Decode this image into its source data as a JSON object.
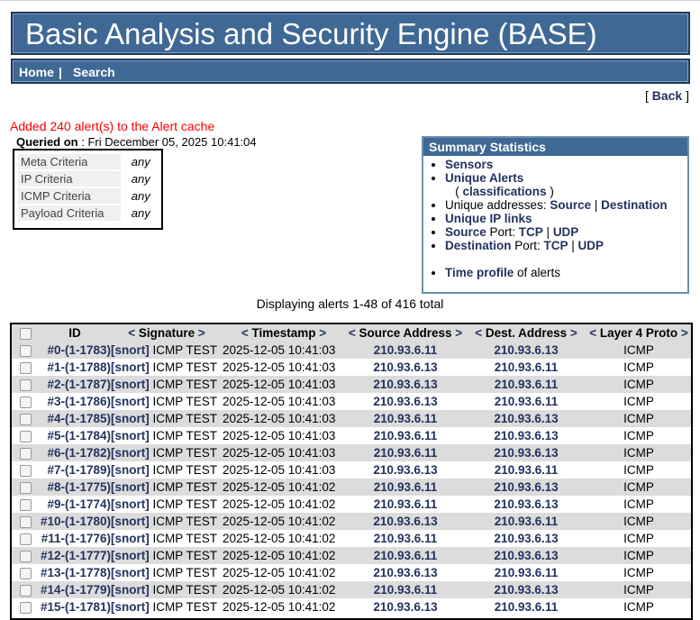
{
  "header": {
    "title": "Basic Analysis and Security Engine (BASE)"
  },
  "nav": {
    "home": "Home",
    "sep": "|",
    "search": "Search"
  },
  "back": {
    "open": "[ ",
    "label": "Back",
    "close": " ]"
  },
  "cache_message": "Added 240 alert(s) to the Alert cache",
  "queried": {
    "label": "Queried on",
    "value": " : Fri December 05, 2025 10:41:04"
  },
  "criteria": [
    {
      "label": "Meta Criteria",
      "value": "any"
    },
    {
      "label": "IP Criteria",
      "value": "any"
    },
    {
      "label": "ICMP Criteria",
      "value": "any"
    },
    {
      "label": "Payload Criteria",
      "value": "any"
    }
  ],
  "summary": {
    "title": "Summary Statistics",
    "sensors": "Sensors",
    "unique_alerts": "Unique Alerts",
    "classifications_open": "( ",
    "classifications": "classifications",
    "classifications_close": " )",
    "unique_addresses_label": "Unique addresses: ",
    "source": "Source",
    "pipe": " | ",
    "destination": "Destination",
    "unique_ip_links": "Unique IP links",
    "source_port_link": "Source",
    "port_label": " Port: ",
    "tcp": "TCP",
    "udp": "UDP",
    "destination_port_link": "Destination",
    "time_profile": "Time profile",
    "of_alerts": " of alerts"
  },
  "displaying": "Displaying alerts 1-48 of 416 total",
  "table": {
    "columns": {
      "id": "ID",
      "signature": "Signature",
      "timestamp": "Timestamp",
      "source": "Source Address",
      "dest": "Dest. Address",
      "proto": "Layer 4 Proto"
    },
    "arrow_left": "<",
    "arrow_right": ">",
    "rows": [
      {
        "id": "#0-(1-1783)",
        "sig_tag": "[snort]",
        "sig": " ICMP TEST",
        "ts": "2025-12-05 10:41:03",
        "src": "210.93.6.11",
        "dst": "210.93.6.13",
        "proto": "ICMP"
      },
      {
        "id": "#1-(1-1788)",
        "sig_tag": "[snort]",
        "sig": " ICMP TEST",
        "ts": "2025-12-05 10:41:03",
        "src": "210.93.6.13",
        "dst": "210.93.6.11",
        "proto": "ICMP"
      },
      {
        "id": "#2-(1-1787)",
        "sig_tag": "[snort]",
        "sig": " ICMP TEST",
        "ts": "2025-12-05 10:41:03",
        "src": "210.93.6.13",
        "dst": "210.93.6.11",
        "proto": "ICMP"
      },
      {
        "id": "#3-(1-1786)",
        "sig_tag": "[snort]",
        "sig": " ICMP TEST",
        "ts": "2025-12-05 10:41:03",
        "src": "210.93.6.13",
        "dst": "210.93.6.11",
        "proto": "ICMP"
      },
      {
        "id": "#4-(1-1785)",
        "sig_tag": "[snort]",
        "sig": " ICMP TEST",
        "ts": "2025-12-05 10:41:03",
        "src": "210.93.6.11",
        "dst": "210.93.6.13",
        "proto": "ICMP"
      },
      {
        "id": "#5-(1-1784)",
        "sig_tag": "[snort]",
        "sig": " ICMP TEST",
        "ts": "2025-12-05 10:41:03",
        "src": "210.93.6.11",
        "dst": "210.93.6.13",
        "proto": "ICMP"
      },
      {
        "id": "#6-(1-1782)",
        "sig_tag": "[snort]",
        "sig": " ICMP TEST",
        "ts": "2025-12-05 10:41:03",
        "src": "210.93.6.11",
        "dst": "210.93.6.13",
        "proto": "ICMP"
      },
      {
        "id": "#7-(1-1789)",
        "sig_tag": "[snort]",
        "sig": " ICMP TEST",
        "ts": "2025-12-05 10:41:03",
        "src": "210.93.6.13",
        "dst": "210.93.6.11",
        "proto": "ICMP"
      },
      {
        "id": "#8-(1-1775)",
        "sig_tag": "[snort]",
        "sig": " ICMP TEST",
        "ts": "2025-12-05 10:41:02",
        "src": "210.93.6.11",
        "dst": "210.93.6.13",
        "proto": "ICMP"
      },
      {
        "id": "#9-(1-1774)",
        "sig_tag": "[snort]",
        "sig": " ICMP TEST",
        "ts": "2025-12-05 10:41:02",
        "src": "210.93.6.11",
        "dst": "210.93.6.13",
        "proto": "ICMP"
      },
      {
        "id": "#10-(1-1780)",
        "sig_tag": "[snort]",
        "sig": " ICMP TEST",
        "ts": "2025-12-05 10:41:02",
        "src": "210.93.6.13",
        "dst": "210.93.6.11",
        "proto": "ICMP"
      },
      {
        "id": "#11-(1-1776)",
        "sig_tag": "[snort]",
        "sig": " ICMP TEST",
        "ts": "2025-12-05 10:41:02",
        "src": "210.93.6.11",
        "dst": "210.93.6.13",
        "proto": "ICMP"
      },
      {
        "id": "#12-(1-1777)",
        "sig_tag": "[snort]",
        "sig": " ICMP TEST",
        "ts": "2025-12-05 10:41:02",
        "src": "210.93.6.11",
        "dst": "210.93.6.13",
        "proto": "ICMP"
      },
      {
        "id": "#13-(1-1778)",
        "sig_tag": "[snort]",
        "sig": " ICMP TEST",
        "ts": "2025-12-05 10:41:02",
        "src": "210.93.6.13",
        "dst": "210.93.6.11",
        "proto": "ICMP"
      },
      {
        "id": "#14-(1-1779)",
        "sig_tag": "[snort]",
        "sig": " ICMP TEST",
        "ts": "2025-12-05 10:41:02",
        "src": "210.93.6.11",
        "dst": "210.93.6.13",
        "proto": "ICMP"
      },
      {
        "id": "#15-(1-1781)",
        "sig_tag": "[snort]",
        "sig": " ICMP TEST",
        "ts": "2025-12-05 10:41:02",
        "src": "210.93.6.13",
        "dst": "210.93.6.11",
        "proto": "ICMP"
      }
    ]
  }
}
